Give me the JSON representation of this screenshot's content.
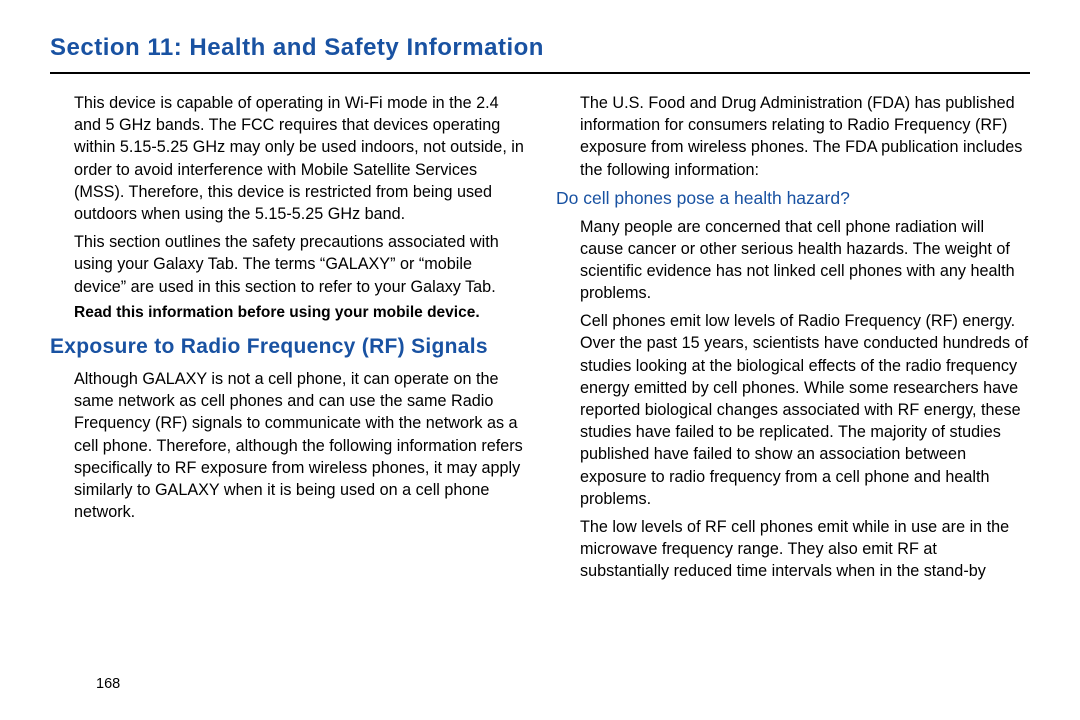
{
  "section_title": "Section 11: Health and Safety Information",
  "left": {
    "p1": "This device is capable of operating in Wi-Fi mode in the 2.4 and 5 GHz bands. The FCC requires that devices operating within 5.15-5.25 GHz may only be used indoors, not outside, in order to avoid interference with Mobile Satellite Services (MSS). Therefore, this device is restricted from being used outdoors when using the 5.15-5.25 GHz band.",
    "p2": "This section outlines the safety precautions associated with using your Galaxy Tab. The terms “GALAXY” or “mobile device” are used in this section to refer to your Galaxy Tab.",
    "bold": "Read this information before using your mobile device.",
    "h2": "Exposure to Radio Frequency (RF) Signals",
    "p3": "Although GALAXY is not a cell phone, it can operate on the same network as cell phones and can use the same Radio Frequency (RF) signals to communicate with the network as a cell phone. Therefore, although the following information refers specifically to RF exposure from wireless phones, it may apply similarly to GALAXY when it is being used on a cell phone network."
  },
  "right": {
    "p1": "The U.S. Food and Drug Administration (FDA) has published information for consumers relating to Radio Frequency (RF) exposure from wireless phones. The FDA publication includes the following information:",
    "sub": "Do cell phones pose a health hazard?",
    "p2": "Many people are concerned that cell phone radiation will cause cancer or other serious health hazards. The weight of scientific evidence has not linked cell phones with any health problems.",
    "p3": "Cell phones emit low levels of Radio Frequency (RF) energy. Over the past 15 years, scientists have conducted hundreds of studies looking at the biological effects of the radio frequency energy emitted by cell phones. While some researchers have reported biological changes associated with RF energy, these studies have failed to be replicated. The majority of studies published have failed to show an association between exposure to radio frequency from a cell phone and health problems.",
    "p4": "The low levels of RF cell phones emit while in use are in the microwave frequency range. They also emit RF at substantially reduced time intervals when in the stand-by"
  },
  "page_number": "168"
}
